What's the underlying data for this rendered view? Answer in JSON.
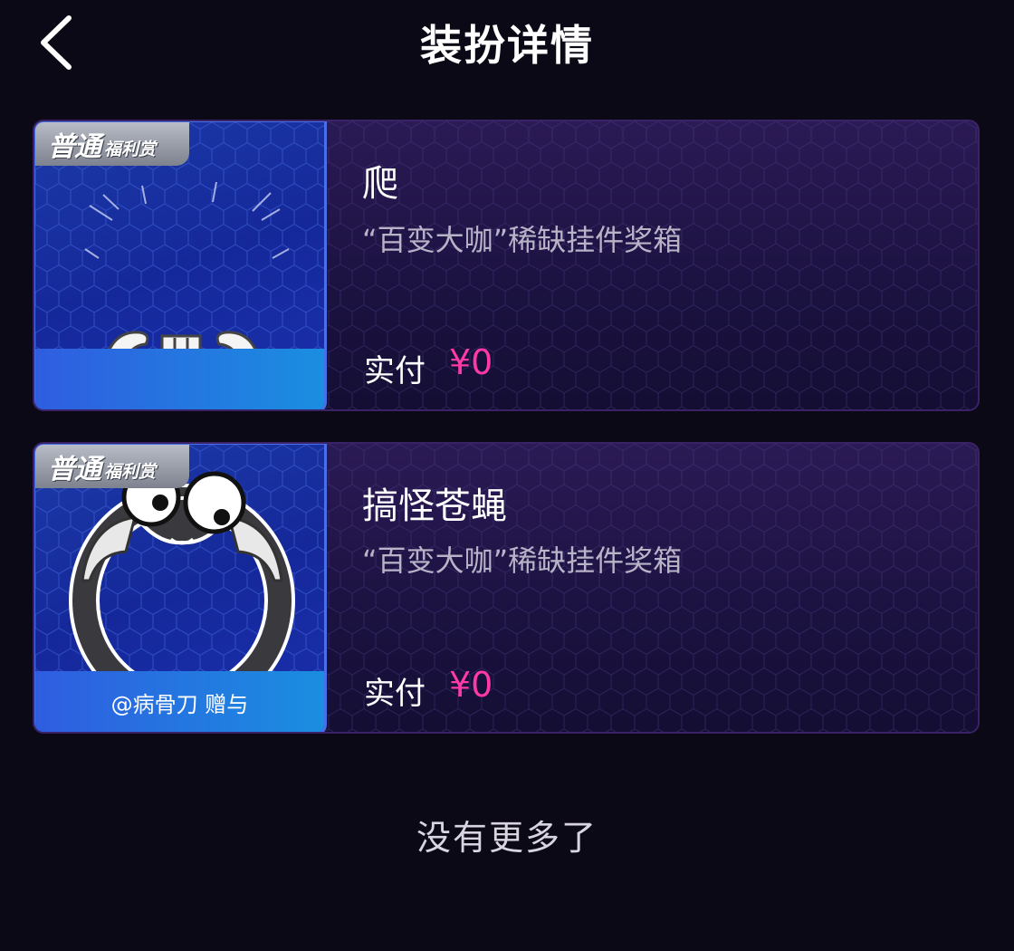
{
  "header": {
    "title": "装扮详情",
    "back_icon": "chevron-left-icon"
  },
  "items": [
    {
      "badge_main": "普通",
      "badge_sub": "福利赏",
      "name": "爬",
      "desc": "“百变大咖”稀缺挂件奖箱",
      "pay_label": "实付",
      "pay_value": "¥0",
      "footer": "",
      "thumb_icon": "muscle-arms-sticker-icon"
    },
    {
      "badge_main": "普通",
      "badge_sub": "福利赏",
      "name": "搞怪苍蝇",
      "desc": "“百变大咖”稀缺挂件奖箱",
      "pay_label": "实付",
      "pay_value": "¥0",
      "footer": "@病骨刀 赠与",
      "thumb_icon": "fly-ring-frame-icon"
    }
  ],
  "footer": {
    "no_more": "没有更多了"
  },
  "colors": {
    "background": "#0c0916",
    "price": "#ff3aa8",
    "accent_blue": "#2f5de0"
  }
}
